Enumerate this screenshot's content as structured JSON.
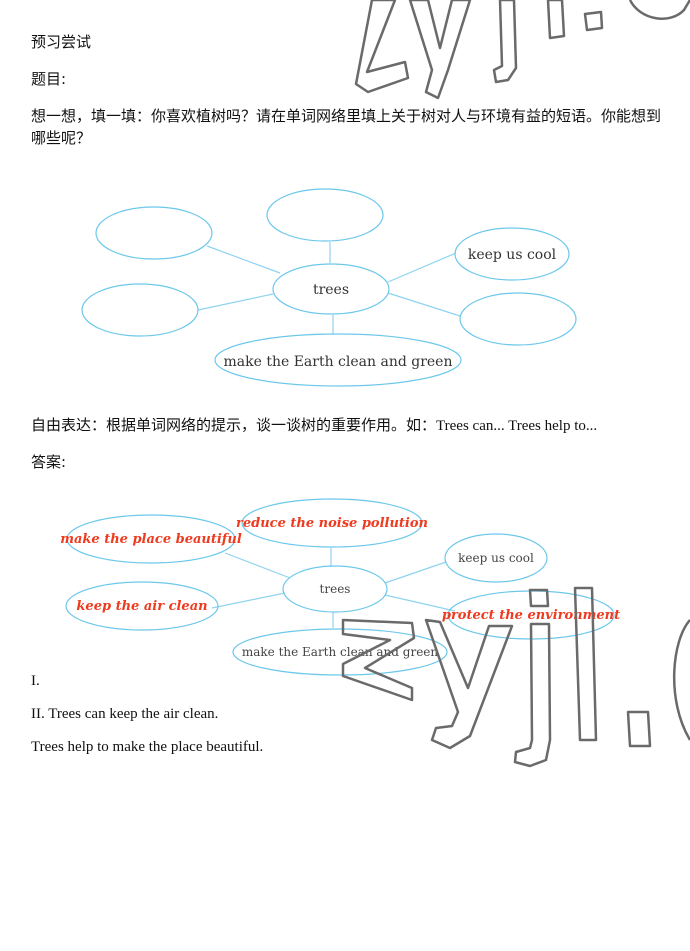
{
  "section_title": "预习尝试",
  "question_label": "题目:",
  "question_text": "想一想，填一填：你喜欢植树吗？请在单词网络里填上关于树对人与环境有益的短语。你能想到哪些呢？",
  "question_diagram": {
    "center": "trees",
    "nodes": [
      {
        "position": "top-left",
        "text": ""
      },
      {
        "position": "top",
        "text": ""
      },
      {
        "position": "right-top",
        "text": "keep us cool"
      },
      {
        "position": "left",
        "text": ""
      },
      {
        "position": "right-bottom",
        "text": ""
      },
      {
        "position": "bottom",
        "text": "make the Earth clean and green"
      }
    ]
  },
  "free_expression": {
    "text_cn": "自由表达：根据单词网络的提示，谈一谈树的重要作用。如：",
    "text_en": "Trees can... Trees help to..."
  },
  "answer_label": "答案:",
  "answer_diagram": {
    "center": "trees",
    "nodes": [
      {
        "position": "top-left",
        "text": "make the place beautiful",
        "filled_in": true
      },
      {
        "position": "top",
        "text": "reduce the noise pollution",
        "filled_in": true
      },
      {
        "position": "right-top",
        "text": "keep us cool",
        "filled_in": false
      },
      {
        "position": "left",
        "text": "keep the air clean",
        "filled_in": true
      },
      {
        "position": "right-bottom",
        "text": "protect the environment",
        "filled_in": true
      },
      {
        "position": "bottom",
        "text": "make the Earth clean and green",
        "filled_in": false
      }
    ]
  },
  "answers": {
    "part1": "I.",
    "part2_line1": "II. Trees can keep the air clean.",
    "part2_line2": "Trees help to make the place beautiful."
  },
  "watermark": "zyjl.cn",
  "colors": {
    "ellipse_stroke": "#6cc8ea",
    "answer_text": "#ee3a1f",
    "watermark_stroke": "#6a6a6a"
  }
}
